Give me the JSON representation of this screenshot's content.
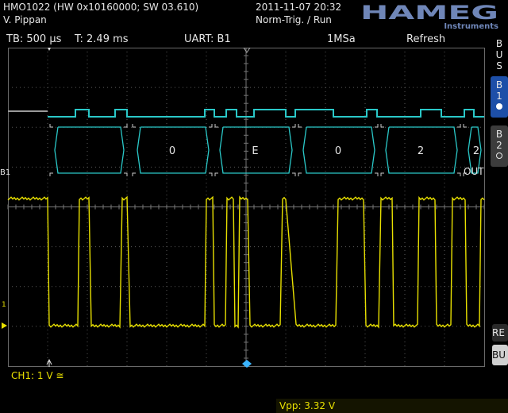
{
  "header": {
    "device": "HMO1022 (HW 0x10160000; SW 03.610)",
    "user": "V. Pippan",
    "datetime": "2011-11-07 20:32",
    "trigger_state": "Norm-Trig. / Run",
    "brand": "HAMEG",
    "brand_sub": "Instruments"
  },
  "info_bar": {
    "timebase": "TB: 500 µs",
    "trigger_time": "T: 2.49 ms",
    "bus": "UART: B1",
    "sample_rate": "1MSa",
    "mode": "Refresh"
  },
  "side_buttons": {
    "bus": [
      "B",
      "U",
      "S"
    ],
    "b1": [
      "B",
      "1"
    ],
    "b2": [
      "B",
      "2"
    ],
    "re": "RE",
    "bu": "BU"
  },
  "scope": {
    "b1_label": "B1",
    "decoded_frames": [
      "",
      "0",
      "E",
      "0",
      "2",
      "2"
    ],
    "out_label": "OUT",
    "colors": {
      "bus": "#2ac8c8",
      "ch1": "#e8e000",
      "grid": "#5a5a5a"
    },
    "ch1_level": "1"
  },
  "status": {
    "ch1": "CH1: 1 V ≅",
    "vpp": "Vpp: 3.32 V"
  }
}
